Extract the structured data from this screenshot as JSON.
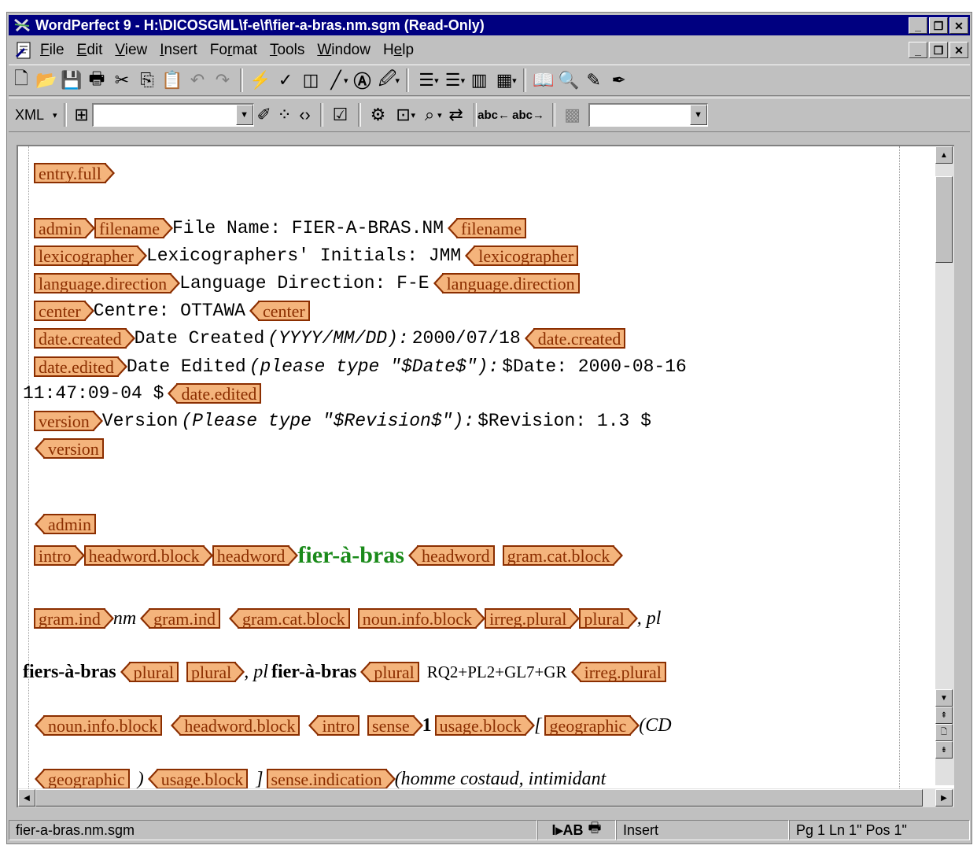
{
  "title": "WordPerfect 9 - H:\\DICOSGML\\f-e\\f\\fier-a-bras.nm.sgm (Read-Only)",
  "menu": [
    "File",
    "Edit",
    "View",
    "Insert",
    "Format",
    "Tools",
    "Window",
    "Help"
  ],
  "menu_underline": [
    "F",
    "E",
    "V",
    "I",
    "r",
    "T",
    "W",
    "e"
  ],
  "toolbar2": {
    "xml_label": "XML",
    "element_combo": "",
    "attr_combo": ""
  },
  "doc": {
    "entry_full": "entry.full",
    "admin": "admin",
    "filename_tag": "filename",
    "filename_text": "File Name:  FIER-A-BRAS.NM",
    "lexicographer_tag": "lexicographer",
    "lexicographer_text": "Lexicographers' Initials:  JMM",
    "language_tag": "language.direction",
    "language_text": "Language Direction:  F-E",
    "center_tag": "center",
    "center_text": "Centre:  OTTAWA",
    "date_created_tag": "date.created",
    "date_created_label": "Date Created",
    "date_created_hint": "(YYYY/MM/DD):",
    "date_created_value": " 2000/07/18",
    "date_edited_tag": "date.edited",
    "date_edited_label": "Date Edited",
    "date_edited_hint": "(please type \"$Date$\"):",
    "date_edited_value": " $Date: 2000-08-16",
    "date_edited_value2": "11:47:09-04 $",
    "version_tag": "version",
    "version_label": "Version",
    "version_hint": "(Please type \"$Revision$\"):",
    "version_value": " $Revision: 1.3 $",
    "intro_tag": "intro",
    "headword_block_tag": "headword.block",
    "headword_tag": "headword",
    "headword": "fier-à-bras",
    "gram_cat_block_tag": "gram.cat.block",
    "gram_ind_tag": "gram.ind",
    "gram_ind": "nm",
    "noun_info_block_tag": "noun.info.block",
    "irreg_plural_tag": "irreg.plural",
    "plural_tag": "plural",
    "pl": ", pl",
    "plural1": "fiers-à-bras",
    "plural2": "fier-à-bras",
    "codes": "RQ2+PL2+GL7+GR",
    "sense_tag": "sense",
    "sense_num": "1",
    "usage_block_tag": "usage.block",
    "bracket_open": "[",
    "geographic_tag": "geographic",
    "geo_text": "(CD",
    "paren_close": ")",
    "bracket_close": "]",
    "sense_indication_tag": "sense.indication",
    "sense_indication_text": "(homme costaud, intimidant"
  },
  "status": {
    "filename": "fier-a-bras.nm.sgm",
    "mode": "Insert",
    "position": "Pg 1 Ln 1\" Pos 1\""
  }
}
